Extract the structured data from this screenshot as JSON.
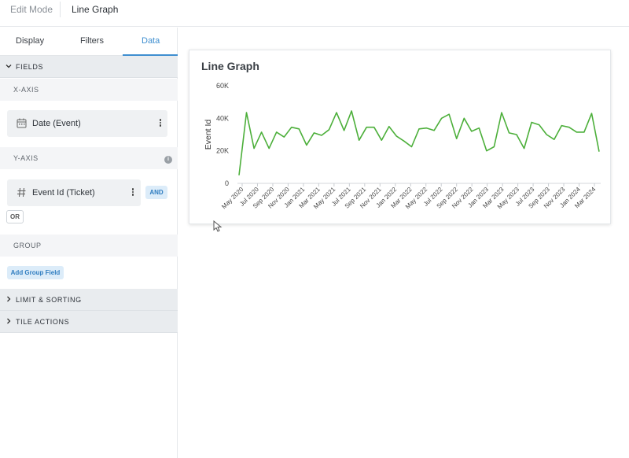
{
  "topbar": {
    "mode": "Edit Mode",
    "title": "Line Graph"
  },
  "tabs": [
    "Display",
    "Filters",
    "Data"
  ],
  "sections": {
    "fields": "FIELDS",
    "x_axis": "X-AXIS",
    "y_axis": "Y-AXIS",
    "group": "GROUP",
    "limit": "LIMIT & SORTING",
    "tile_actions": "TILE ACTIONS"
  },
  "x_field": {
    "label": "Date (Event)",
    "icon": "calendar-icon"
  },
  "y_field": {
    "label": "Event Id (Ticket)",
    "icon": "hash-icon"
  },
  "buttons": {
    "and": "AND",
    "or": "OR",
    "add_group": "Add Group Field"
  },
  "info_icon": "i",
  "colors": {
    "accent": "#3f8fd0",
    "line": "#4caf3a"
  },
  "tile": {
    "title": "Line Graph"
  },
  "chart_data": {
    "type": "line",
    "ylabel": "Event Id",
    "ylim": [
      0,
      60000
    ],
    "yticks": [
      0,
      20000,
      40000,
      60000
    ],
    "ytick_labels": [
      "0",
      "20K",
      "40K",
      "60K"
    ],
    "xtick_labels": [
      "May 2020",
      "Jul 2020",
      "Sep 2020",
      "Nov 2020",
      "Jan 2021",
      "Mar 2021",
      "May 2021",
      "Jul 2021",
      "Sep 2021",
      "Nov 2021",
      "Jan 2022",
      "Mar 2022",
      "May 2022",
      "Jul 2022",
      "Sep 2022",
      "Nov 2022",
      "Jan 2023",
      "Mar 2023",
      "May 2023",
      "Jul 2023",
      "Sep 2023",
      "Nov 2023",
      "Jan 2024",
      "Mar 2024"
    ],
    "series": [
      {
        "color": "#4caf3a",
        "values": [
          5000,
          43500,
          21500,
          31500,
          21500,
          31500,
          28500,
          34500,
          33500,
          23500,
          31000,
          29500,
          33000,
          43500,
          32500,
          44500,
          26500,
          34500,
          34500,
          26500,
          35000,
          29000,
          26000,
          22500,
          33500,
          34000,
          32500,
          40000,
          42500,
          27500,
          40000,
          32000,
          34000,
          20000,
          22500,
          43500,
          31000,
          30000,
          21500,
          37500,
          36000,
          30000,
          27000,
          35500,
          34500,
          31500,
          31500,
          43000,
          19500
        ]
      }
    ],
    "grid": false,
    "legend": "none"
  }
}
